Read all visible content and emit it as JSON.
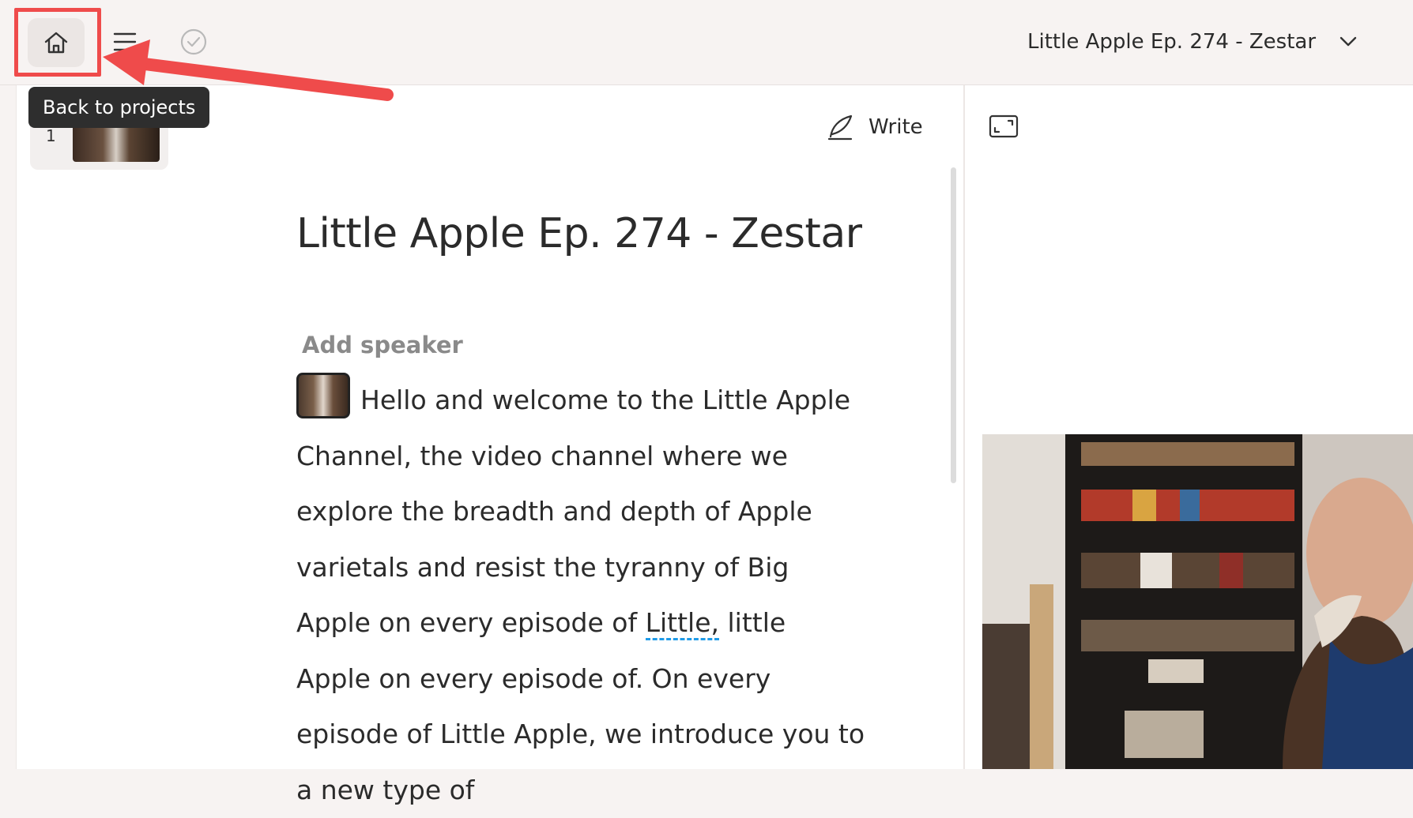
{
  "topbar": {
    "home_tooltip": "Back to projects",
    "project_title": "Little Apple Ep. 274 - Zestar"
  },
  "sidebar": {
    "scenes": [
      {
        "number": "1"
      }
    ]
  },
  "toolbar": {
    "write_label": "Write"
  },
  "document": {
    "title": "Little Apple Ep. 274 - Zestar",
    "add_speaker": "Add speaker",
    "transcript_part1": "Hello and welcome to the Little Apple Channel, the video channel where we explore the breadth and depth of Apple varietals and resist the tyranny of Big Apple on every episode of ",
    "transcript_flagged_word": "Little,",
    "transcript_part2": " little Apple on every episode of. On every episode of Little Apple, we introduce you to a new type of"
  },
  "colors": {
    "accent_red": "#ef4b4b",
    "tooltip_bg": "#2e2e2e",
    "spelling_underline": "#1f9be8",
    "topbar_bg": "#f7f3f2"
  },
  "icons": {
    "home": "home-icon",
    "menu": "hamburger-menu-icon",
    "status": "check-circle-icon",
    "dropdown": "chevron-down-icon",
    "write": "quill-pen-icon",
    "fit": "aspect-ratio-icon"
  }
}
